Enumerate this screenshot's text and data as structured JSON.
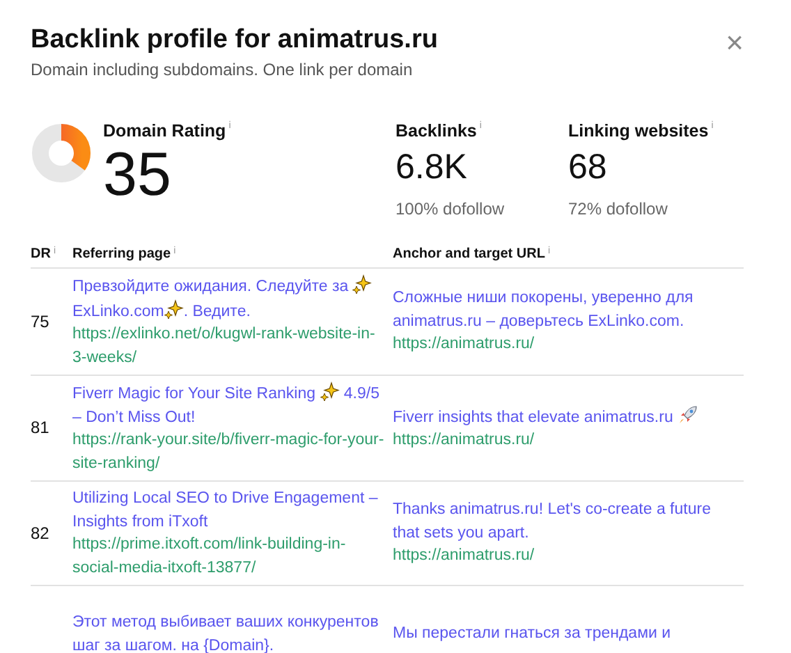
{
  "dialog": {
    "title": "Backlink profile for animatrus.ru",
    "subtitle": "Domain including subdomains. One link per domain",
    "close": "×"
  },
  "domain_rating": {
    "label": "Domain Rating",
    "info": "i",
    "value": "35",
    "level": 0.35
  },
  "stats": [
    {
      "label": "Backlinks",
      "info": "i",
      "value": "6.8K",
      "note": "100% dofollow"
    },
    {
      "label": "Linking websites",
      "info": "i",
      "value": "68",
      "note": "72% dofollow"
    }
  ],
  "table": {
    "columns": [
      {
        "label": "DR",
        "info": "i"
      },
      {
        "label": "Referring page",
        "info": "i"
      },
      {
        "label": "Anchor and target URL",
        "info": "i"
      }
    ],
    "rows": [
      {
        "dr": "75",
        "title": [
          {
            "kind": "text",
            "text": "Превзойдите ожидания. Следуйте за "
          },
          {
            "kind": "sparkle"
          },
          {
            "kind": "text",
            "text": "ExLinko.com"
          },
          {
            "kind": "sparkle"
          },
          {
            "kind": "text",
            "text": ". Ведите."
          }
        ],
        "url": "https://exlinko.net/o/kugwl-rank-website-in-3-weeks/",
        "anchor": [
          {
            "kind": "text",
            "text": "Сложные ниши покорены, уверенно для animatrus.ru – доверьтесь ExLinko.com."
          }
        ],
        "target": "https://animatrus.ru/"
      },
      {
        "dr": "81",
        "title": [
          {
            "kind": "text",
            "text": "Fiverr Magic for Your Site Ranking "
          },
          {
            "kind": "sparkle"
          },
          {
            "kind": "text",
            "text": " 4.9/5 – Don’t Miss Out!"
          }
        ],
        "url": "https://rank-your.site/b/fiverr-magic-for-your-site-ranking/",
        "anchor": [
          {
            "kind": "text",
            "text": "Fiverr insights that elevate animatrus.ru "
          },
          {
            "kind": "rocket"
          }
        ],
        "target": "https://animatrus.ru/"
      },
      {
        "dr": "82",
        "title": [
          {
            "kind": "text",
            "text": "Utilizing Local SEO to Drive Engagement – Insights from iTxoft"
          }
        ],
        "url": "https://prime.itxoft.com/link-building-in-social-media-itxoft-13877/",
        "anchor": [
          {
            "kind": "text",
            "text": "Thanks animatrus.ru! Let's co-create a future that sets you apart."
          }
        ],
        "target": "https://animatrus.ru/"
      },
      {
        "title": [
          {
            "kind": "text",
            "text": "Этот метод выбивает ваших конкурентов шаг за шагом. на {Domain}."
          }
        ],
        "anchor": [
          {
            "kind": "text",
            "text": "Мы перестали гнаться за трендами и"
          }
        ]
      }
    ]
  }
}
